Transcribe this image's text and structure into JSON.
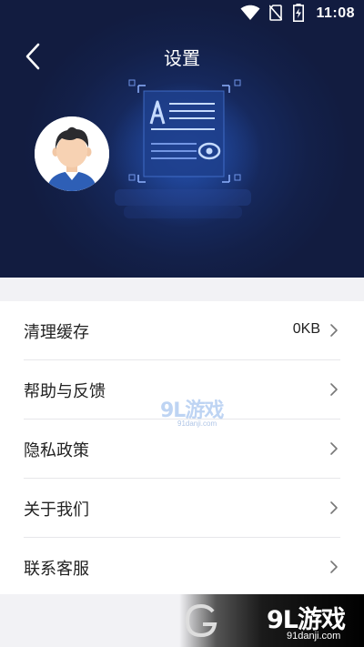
{
  "status_bar": {
    "time": "11:08",
    "icons": [
      "wifi-icon",
      "no-sim-icon",
      "battery-charging-icon"
    ]
  },
  "header": {
    "title": "设置",
    "back_icon": "chevron-left-icon",
    "avatar_icon": "user-avatar",
    "illustration_icon": "document-scan-icon",
    "background_color": "#132049"
  },
  "settings": {
    "items": [
      {
        "label": "清理缓存",
        "value": "0KB",
        "icon": "chevron-right-icon"
      },
      {
        "label": "帮助与反馈",
        "value": "",
        "icon": "chevron-right-icon"
      },
      {
        "label": "隐私政策",
        "value": "",
        "icon": "chevron-right-icon"
      },
      {
        "label": "关于我们",
        "value": "",
        "icon": "chevron-right-icon"
      },
      {
        "label": "联系客服",
        "value": "",
        "icon": "chevron-right-icon"
      }
    ]
  },
  "watermark": {
    "center_logo": "9L游戏",
    "center_url": "91danji.com",
    "corner_logo": "9L游戏",
    "corner_url": "91danji.com"
  },
  "colors": {
    "accent": "#1d3f8a",
    "list_background": "#ffffff",
    "page_background": "#f2f2f5",
    "text_primary": "#222222",
    "divider": "#e7e7ea"
  }
}
